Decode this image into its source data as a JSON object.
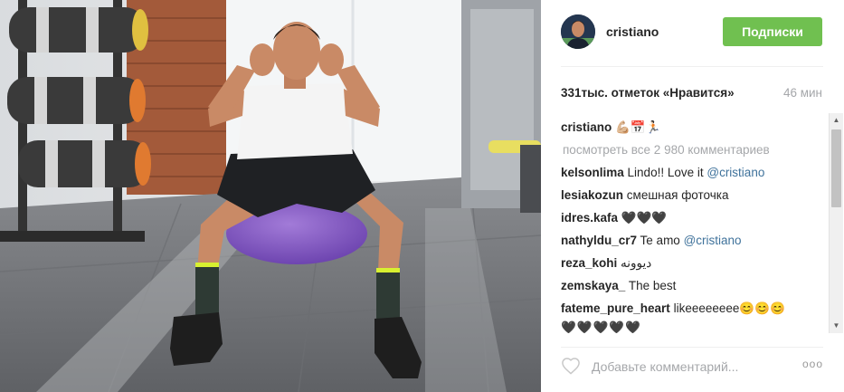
{
  "post": {
    "username": "cristiano",
    "follow_label": "Подписки",
    "likes": "331тыс. отметок «Нравится»",
    "time": "46 мин",
    "caption": {
      "author": "cristiano",
      "text": "💪🏼📅🏃🏻"
    },
    "view_all": "посмотреть все 2 980 комментариев",
    "comments": [
      {
        "author": "kelsonlima",
        "text": "Lindo!! Love it ",
        "mention": "@cristiano"
      },
      {
        "author": "lesiakozun",
        "text": "смешная фоточка",
        "mention": ""
      },
      {
        "author": "idres.kafa",
        "text": "🖤🖤🖤",
        "mention": ""
      },
      {
        "author": "nathyldu_cr7",
        "text": "Te amo ",
        "mention": "@cristiano"
      },
      {
        "author": "reza_kohi",
        "text": "دیوونه",
        "mention": ""
      },
      {
        "author": "zemskaya_",
        "text": "The best",
        "mention": ""
      },
      {
        "author": "fateme_pure_heart",
        "text": "likeeeeeeee😊😊😊",
        "mention": ""
      }
    ],
    "comment_continued": "🖤🖤🖤🖤🖤",
    "comment_placeholder": "Добавьте комментарий...",
    "more_label": "ooo"
  },
  "colors": {
    "follow_button": "#70c050",
    "mention": "#3f729b",
    "muted": "#a5a7aa",
    "text": "#262626"
  },
  "icons": {
    "like": "heart-icon",
    "more": "more-options-icon",
    "scroll_up": "arrow-up-icon",
    "scroll_down": "arrow-down-icon"
  }
}
